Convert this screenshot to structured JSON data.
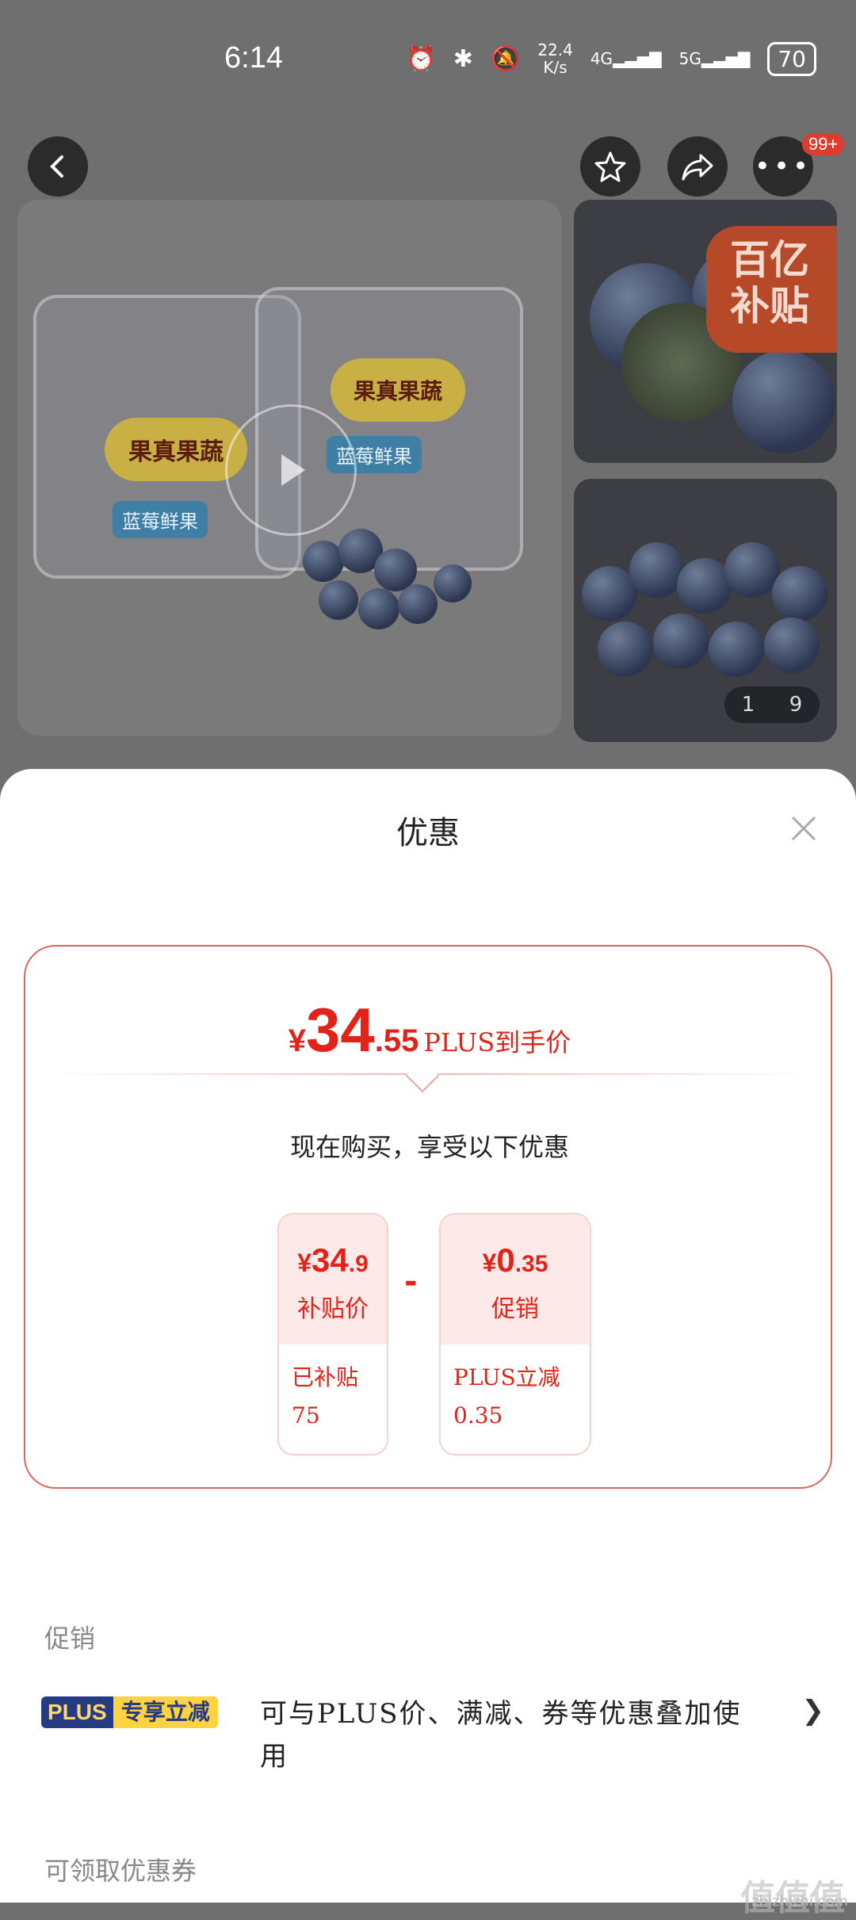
{
  "status_bar": {
    "time": "6:14",
    "net_speed_top": "22.4",
    "net_speed_bottom": "K/s",
    "signal1": "4G",
    "signal2": "5G",
    "battery": "70"
  },
  "header": {
    "badge": "99+"
  },
  "gallery": {
    "label_brand": "果真果蔬",
    "label_product": "蓝莓鲜果",
    "subsidy_line1": "百亿",
    "subsidy_line2": "补贴",
    "counter_current": "1",
    "counter_total": "9"
  },
  "sheet": {
    "title": "优惠",
    "final": {
      "currency": "¥",
      "integer": "34",
      "decimal": ".55",
      "label": "PLUS到手价"
    },
    "enjoy_text": "现在购买，享受以下优惠",
    "boxes": [
      {
        "currency": "¥",
        "integer": "34",
        "decimal": ".9",
        "name": "补贴价",
        "detail1": "已补贴",
        "detail2": "75"
      },
      {
        "currency": "¥",
        "integer": "0",
        "decimal": ".35",
        "name": "促销",
        "detail1": "PLUS立减",
        "detail2": "0.35"
      }
    ],
    "minus": "-",
    "promo_section": "促销",
    "plus_tag_a": "PLUS",
    "plus_tag_b": "专享立减",
    "promo_desc": "可与PLUS价、满减、券等优惠叠加使用",
    "coupon_section": "可领取优惠券"
  },
  "watermark": {
    "logo": "值值值",
    "url": "zhizhizhi.com"
  }
}
